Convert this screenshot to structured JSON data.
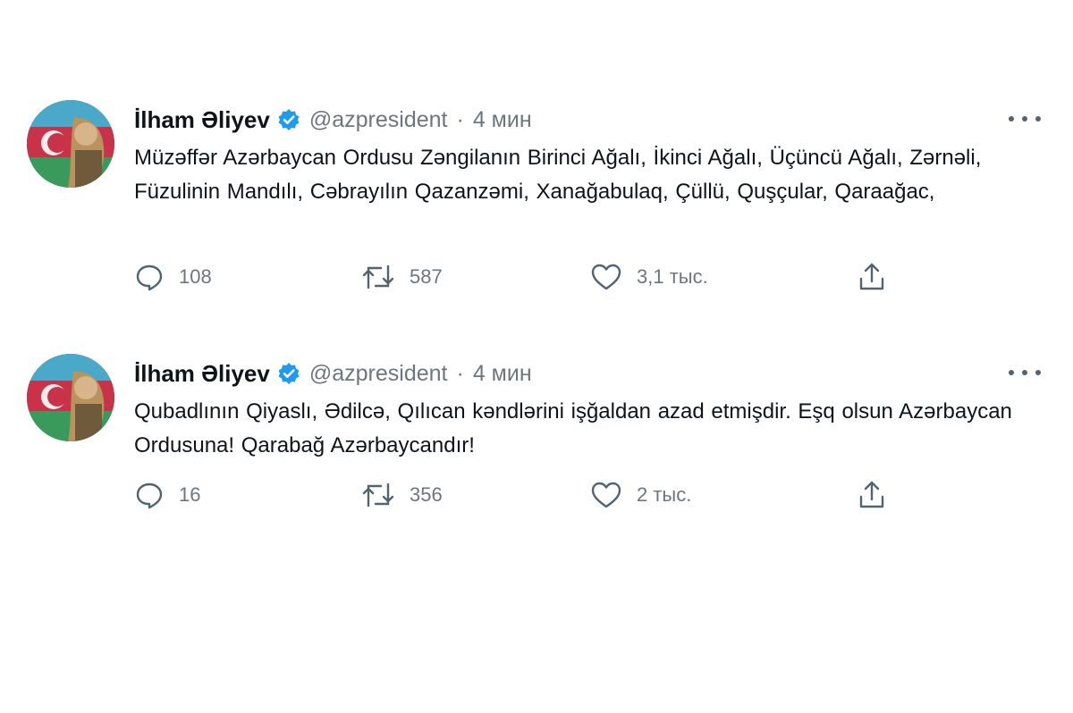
{
  "tweets": [
    {
      "author": "İlham Əliyev",
      "handle": "@azpresident",
      "separator": "·",
      "time": "4 мин",
      "text": "Müzəffər Azərbaycan Ordusu Zəngilanın Birinci Ağalı, İkinci Ağalı, Üçüncü Ağalı, Zərnəli, Füzulinin Mandılı, Cəbrayılın Qazanzəmi, Xanağabulaq, Çüllü, Quşçular, Qaraağac,",
      "replies": "108",
      "retweets": "587",
      "likes": "3,1 тыс."
    },
    {
      "author": "İlham Əliyev",
      "handle": "@azpresident",
      "separator": "·",
      "time": "4 мин",
      "text": "Qubadlının Qiyaslı, Ədilcə, Qılıcan kəndlərini işğaldan azad etmişdir. Eşq olsun Azərbaycan Ordusuna! Qarabağ Azərbaycandır!",
      "replies": "16",
      "retweets": "356",
      "likes": "2 тыс."
    }
  ],
  "icons": {
    "verified": "verified-badge-icon",
    "more": "more-icon",
    "reply": "reply-icon",
    "retweet": "retweet-icon",
    "like": "like-icon",
    "share": "share-icon"
  },
  "colors": {
    "text": "#0f1419",
    "muted": "#6e767d",
    "verified": "#1d9bf0"
  }
}
